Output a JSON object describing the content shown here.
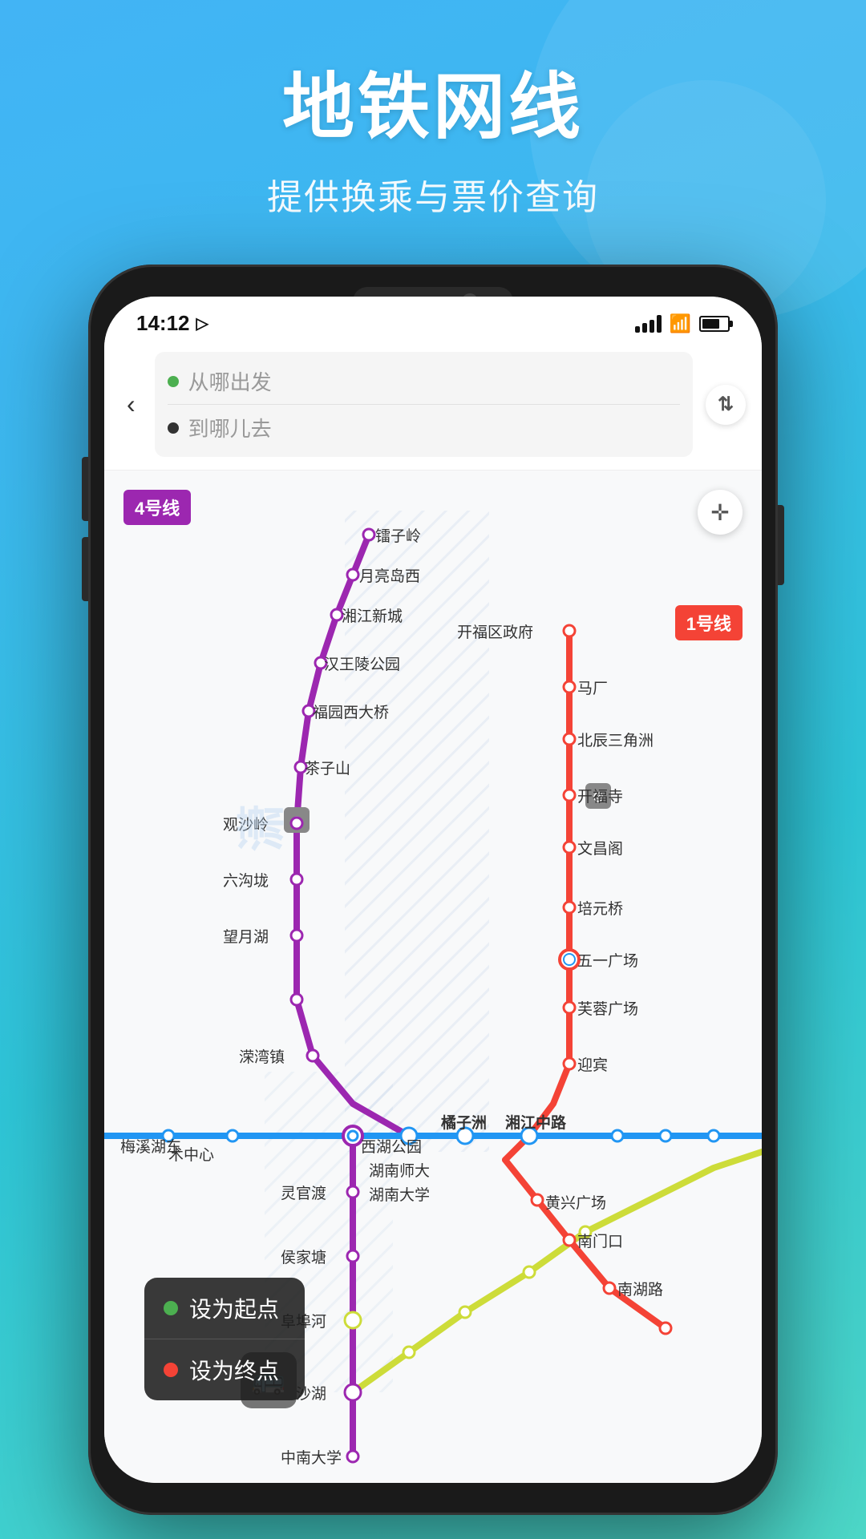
{
  "header": {
    "title": "地铁网线",
    "subtitle": "提供换乘与票价查询"
  },
  "status_bar": {
    "time": "14:12",
    "navigation_icon": "▷"
  },
  "search": {
    "back_label": "‹",
    "from_placeholder": "从哪出发",
    "to_placeholder": "到哪儿去",
    "swap_icon": "⇅"
  },
  "map": {
    "line4_badge": "4号线",
    "line1_badge": "1号线",
    "locator_icon": "✛",
    "watermark": "潇",
    "stations_line4": [
      "镭子岭",
      "月亮岛西",
      "湘江新城",
      "汉王陵公园",
      "福园西大桥",
      "茶子山",
      "观沙岭",
      "六沟垅",
      "望月湖",
      "溁湾镇"
    ],
    "stations_line1": [
      "开福区政府",
      "马厂",
      "北辰三角洲",
      "开福寺",
      "文昌阁",
      "培元桥",
      "五一广场",
      "芙蓉广场",
      "黄兴广场",
      "南门口",
      "侯家塘",
      "南湖路"
    ],
    "stations_blue": [
      "梅溪湖东",
      "术中心",
      "西湖公园",
      "湖南师大",
      "湖南大学"
    ],
    "stations_yellow": [
      "阜埠河",
      "碧沙湖",
      "中南大学"
    ],
    "context_menu": {
      "set_start": "设为起点",
      "set_end": "设为终点"
    },
    "transfer_label": "橘子洲",
    "transfer_label2": "湘江中路",
    "extra_labels": [
      "灵官渡",
      "迎宾"
    ]
  }
}
